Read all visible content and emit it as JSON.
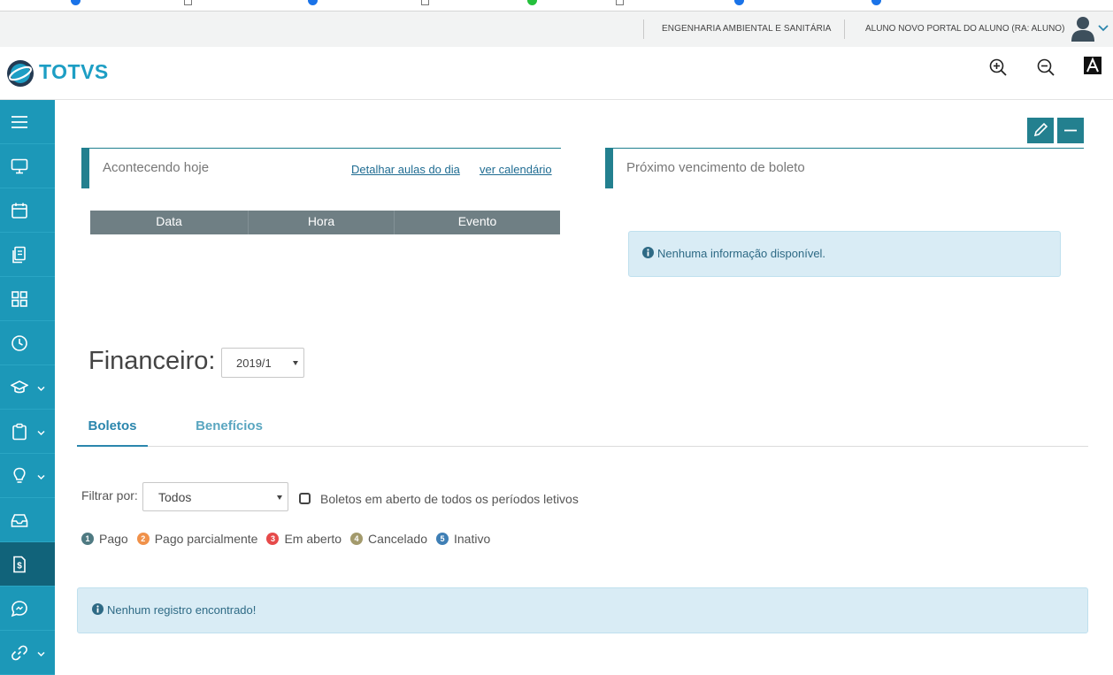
{
  "topbar": {
    "course": "ENGENHARIA AMBIENTAL E SANITÁRIA",
    "user": "ALUNO NOVO PORTAL DO ALUNO (RA: ALUNO)"
  },
  "brand": {
    "name": "TOTVS",
    "color": "#1d9ec4"
  },
  "header": {
    "icons": [
      "zoom-in-icon",
      "zoom-out-icon",
      "font-contrast-icon"
    ]
  },
  "sidebar": {
    "color": "#1c98b8",
    "active_color": "#11637a",
    "items": [
      {
        "icon": "menu-icon",
        "has_submenu": false
      },
      {
        "icon": "monitor-icon",
        "has_submenu": false
      },
      {
        "icon": "calendar-icon",
        "has_submenu": false
      },
      {
        "icon": "documents-icon",
        "has_submenu": false
      },
      {
        "icon": "grid-icon",
        "has_submenu": false
      },
      {
        "icon": "clock-icon",
        "has_submenu": false
      },
      {
        "icon": "graduation-cap-icon",
        "has_submenu": true
      },
      {
        "icon": "clipboard-icon",
        "has_submenu": true
      },
      {
        "icon": "lightbulb-icon",
        "has_submenu": true
      },
      {
        "icon": "inbox-icon",
        "has_submenu": false
      },
      {
        "icon": "financial-document-icon",
        "has_submenu": false,
        "active": true
      },
      {
        "icon": "chat-icon",
        "has_submenu": false
      },
      {
        "icon": "link-icon",
        "has_submenu": true
      }
    ]
  },
  "today_panel": {
    "title": "Acontecendo hoje",
    "link_details": "Detalhar aulas do dia",
    "link_calendar": "ver calendário",
    "columns": [
      "Data",
      "Hora",
      "Evento"
    ],
    "rows": []
  },
  "boleto_panel": {
    "title": "Próximo vencimento de boleto",
    "message": "Nenhuma informação disponível."
  },
  "financeiro": {
    "title": "Financeiro:",
    "period": "2019/1",
    "tabs": [
      {
        "label": "Boletos",
        "active": true
      },
      {
        "label": "Benefícios",
        "active": false
      }
    ],
    "filter_label": "Filtrar por:",
    "filter_value": "Todos",
    "checkbox_label": "Boletos em aberto de todos os períodos letivos",
    "checkbox_checked": false,
    "legend": [
      {
        "num": "1",
        "label": "Pago",
        "color": "#4f7a82"
      },
      {
        "num": "2",
        "label": "Pago parcialmente",
        "color": "#f0914a"
      },
      {
        "num": "3",
        "label": "Em aberto",
        "color": "#e64a4a"
      },
      {
        "num": "4",
        "label": "Cancelado",
        "color": "#a39a6c"
      },
      {
        "num": "5",
        "label": "Inativo",
        "color": "#3f7fb5"
      }
    ],
    "empty_message": "Nenhum registro encontrado!"
  }
}
